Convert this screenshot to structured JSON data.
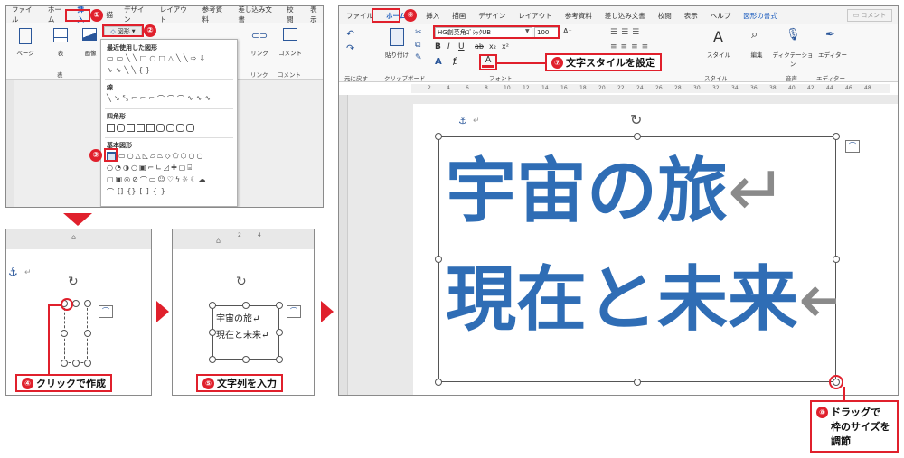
{
  "panel1": {
    "tabs": [
      "ファイル",
      "ホーム",
      "挿入",
      "描",
      "デザイン",
      "レイアウト",
      "参考資料",
      "差し込み文書",
      "校閲",
      "表示"
    ],
    "active_tab": "挿入",
    "tools": {
      "page": "ページ",
      "table": "表",
      "image": "画像",
      "shapes_button": "図形",
      "link": "リンク",
      "comment": "コメント"
    },
    "group_labels": {
      "table": "表",
      "link": "リンク",
      "comment": "コメント"
    },
    "shapes_menu": {
      "recent": "最近使用した図形",
      "lines": "線",
      "rectangles": "四角形",
      "basic": "基本図形"
    }
  },
  "panel2": {
    "anchor_return": "↵"
  },
  "panel3": {
    "ruler_ticks": [
      "2",
      "4"
    ],
    "line1": "宇宙の旅↵",
    "line2": "現在と未来↵"
  },
  "panel4": {
    "tabs": [
      "ファイル",
      "ホーム",
      "挿入",
      "描画",
      "デザイン",
      "レイアウト",
      "参考資料",
      "差し込み文書",
      "校閲",
      "表示",
      "ヘルプ",
      "図形の書式"
    ],
    "active_tab": "ホーム",
    "comment_button": "コメント",
    "font_name": "HG創英角ｺﾞｼｯｸUB",
    "font_size": "100",
    "groups": {
      "undo": "元に戻す",
      "clipboard": "クリップボード",
      "font": "フォント",
      "style": "スタイル",
      "voice": "音声",
      "editor": "エディター"
    },
    "tools": {
      "paste": "貼り付け",
      "style": "スタイル",
      "edit": "編集",
      "dictate": "ディクテーション",
      "editor": "エディター"
    },
    "ruler_ticks": [
      "2",
      "4",
      "6",
      "8",
      "10",
      "12",
      "14",
      "16",
      "18",
      "20",
      "22",
      "24",
      "26",
      "28",
      "30",
      "32",
      "34",
      "36",
      "38",
      "40",
      "42",
      "44",
      "46",
      "48"
    ],
    "doc_line1": "宇宙の旅",
    "doc_line2": "現在と未来",
    "return_mark": "↵",
    "anchor_return": "↵"
  },
  "callouts": {
    "c1": "①",
    "c2": "②",
    "c3": "③",
    "c4_num": "④",
    "c4_text": "クリックで作成",
    "c5_num": "⑤",
    "c5_text": "文字列を入力",
    "c6": "⑥",
    "c7_num": "⑦",
    "c7_text": "文字スタイルを設定",
    "c8_num": "⑧",
    "c8_text": "ドラッグで\n枠のサイズを\n調節"
  },
  "colors": {
    "accent_red": "#e0202c",
    "word_blue": "#185abd",
    "text_blue": "#2f6db5"
  }
}
